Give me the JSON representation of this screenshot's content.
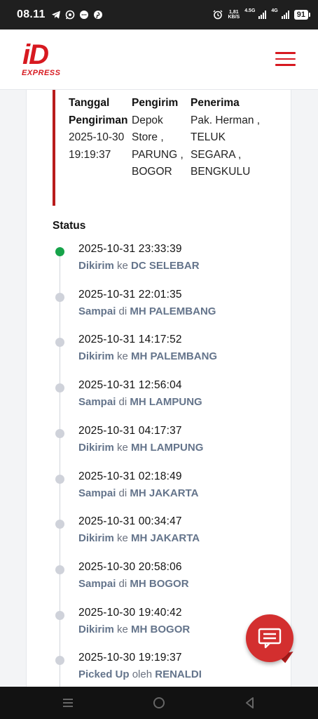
{
  "statusbar": {
    "time": "08.11",
    "net_speed_value": "1,81",
    "net_speed_unit": "KB/S",
    "sig1_label": "4.5G",
    "sig2_label": "4G",
    "battery": "91"
  },
  "header": {
    "logo_id": "iD",
    "logo_express": "EXPRESS"
  },
  "shipment": {
    "date_header": "Tanggal Pengiriman",
    "date_value": "2025-10-30 19:19:37",
    "sender_header": "Pengirim",
    "sender_value": "Depok Store , PARUNG , BOGOR",
    "receiver_header": "Penerima",
    "receiver_value": "Pak. Herman , TELUK SEGARA , BENGKULU"
  },
  "status": {
    "title": "Status",
    "events": [
      {
        "date": "2025-10-31 23:33:39",
        "action": "Dikirim",
        "conn": "ke",
        "place": "DC SELEBAR",
        "active": true
      },
      {
        "date": "2025-10-31 22:01:35",
        "action": "Sampai",
        "conn": "di",
        "place": "MH PALEMBANG",
        "active": false
      },
      {
        "date": "2025-10-31 14:17:52",
        "action": "Dikirim",
        "conn": "ke",
        "place": "MH PALEMBANG",
        "active": false
      },
      {
        "date": "2025-10-31 12:56:04",
        "action": "Sampai",
        "conn": "di",
        "place": "MH LAMPUNG",
        "active": false
      },
      {
        "date": "2025-10-31 04:17:37",
        "action": "Dikirim",
        "conn": "ke",
        "place": "MH LAMPUNG",
        "active": false
      },
      {
        "date": "2025-10-31 02:18:49",
        "action": "Sampai",
        "conn": "di",
        "place": "MH JAKARTA",
        "active": false
      },
      {
        "date": "2025-10-31 00:34:47",
        "action": "Dikirim",
        "conn": "ke",
        "place": "MH JAKARTA",
        "active": false
      },
      {
        "date": "2025-10-30 20:58:06",
        "action": "Sampai",
        "conn": "di",
        "place": "MH BOGOR",
        "active": false
      },
      {
        "date": "2025-10-30 19:40:42",
        "action": "Dikirim",
        "conn": "ke",
        "place": "MH BOGOR",
        "active": false
      },
      {
        "date": "2025-10-30 19:19:37",
        "action": "Picked Up",
        "conn": "oleh",
        "place": "RENALDI",
        "active": false
      }
    ]
  },
  "colors": {
    "brand_red": "#d71920",
    "active_dot": "#16a34a",
    "inactive_dot": "#cfd2da"
  }
}
